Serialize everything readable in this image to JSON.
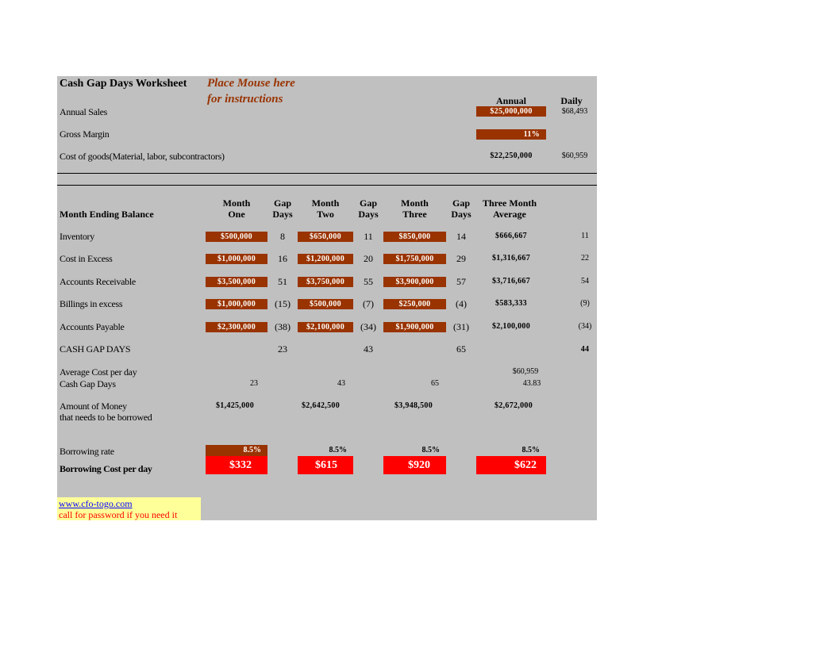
{
  "header": {
    "title": "Cash Gap Days Worksheet",
    "instructions_line1": "Place Mouse here",
    "instructions_line2": "for instructions",
    "col_annual": "Annual",
    "col_daily": "Daily"
  },
  "summary": {
    "annual_sales": {
      "label": "Annual Sales",
      "annual": "$25,000,000",
      "daily": "$68,493"
    },
    "gross_margin": {
      "label": "Gross Margin",
      "annual": "11%"
    },
    "cost_of_goods": {
      "label": "Cost of goods(Material, labor, subcontractors)",
      "annual": "$22,250,000",
      "daily": "$60,959"
    }
  },
  "table": {
    "row_header": "Month Ending Balance",
    "columns": {
      "m1": [
        "Month",
        "One"
      ],
      "g1": [
        "Gap",
        "Days"
      ],
      "m2": [
        "Month",
        "Two"
      ],
      "g2": [
        "Gap",
        "Days"
      ],
      "m3": [
        "Month",
        "Three"
      ],
      "g3": [
        "Gap",
        "Days"
      ],
      "avg": [
        "Three Month",
        "Average"
      ]
    },
    "rows": [
      {
        "label": "Inventory",
        "m1": "$500,000",
        "g1": "8",
        "m2": "$650,000",
        "g2": "11",
        "m3": "$850,000",
        "g3": "14",
        "avg": "$666,667",
        "avg_days": "11"
      },
      {
        "label": "Cost in Excess",
        "m1": "$1,000,000",
        "g1": "16",
        "m2": "$1,200,000",
        "g2": "20",
        "m3": "$1,750,000",
        "g3": "29",
        "avg": "$1,316,667",
        "avg_days": "22"
      },
      {
        "label": "Accounts Receivable",
        "m1": "$3,500,000",
        "g1": "51",
        "m2": "$3,750,000",
        "g2": "55",
        "m3": "$3,900,000",
        "g3": "57",
        "avg": "$3,716,667",
        "avg_days": "54"
      },
      {
        "label": "Billings in excess",
        "m1": "$1,000,000",
        "g1": "(15)",
        "m2": "$500,000",
        "g2": "(7)",
        "m3": "$250,000",
        "g3": "(4)",
        "avg": "$583,333",
        "avg_days": "(9)"
      },
      {
        "label": "Accounts Payable",
        "m1": "$2,300,000",
        "g1": "(38)",
        "m2": "$2,100,000",
        "g2": "(34)",
        "m3": "$1,900,000",
        "g3": "(31)",
        "avg": "$2,100,000",
        "avg_days": "(34)"
      }
    ],
    "cash_gap": {
      "label": "CASH GAP DAYS",
      "g1": "23",
      "g2": "43",
      "g3": "65",
      "avg_days": "44"
    }
  },
  "calc": {
    "avg_cost_label": "Average Cost per day",
    "avg_cost_value": "$60,959",
    "cash_gap_label": "Cash Gap Days",
    "cash_gap_m1": "23",
    "cash_gap_m2": "43",
    "cash_gap_m3": "65",
    "cash_gap_avg": "43.83",
    "borrow_label1": "Amount of Money",
    "borrow_label2": "that needs to be borrowed",
    "borrow_m1": "$1,425,000",
    "borrow_m2": "$2,642,500",
    "borrow_m3": "$3,948,500",
    "borrow_avg": "$2,672,000"
  },
  "borrowing": {
    "rate_label": "Borrowing rate",
    "rate_m1": "8.5%",
    "rate_m2": "8.5%",
    "rate_m3": "8.5%",
    "rate_avg": "8.5%",
    "cost_label": "Borrowing Cost per day",
    "cost_m1": "$332",
    "cost_m2": "$615",
    "cost_m3": "$920",
    "cost_avg": "$622"
  },
  "footer": {
    "link": "www.cfo-togo.com",
    "note": "call for password if you need it"
  },
  "colors": {
    "sheet_bg": "#c0c0c0",
    "input_box": "#993300",
    "result_box": "#ff0000",
    "note_bg": "#ffff99"
  }
}
